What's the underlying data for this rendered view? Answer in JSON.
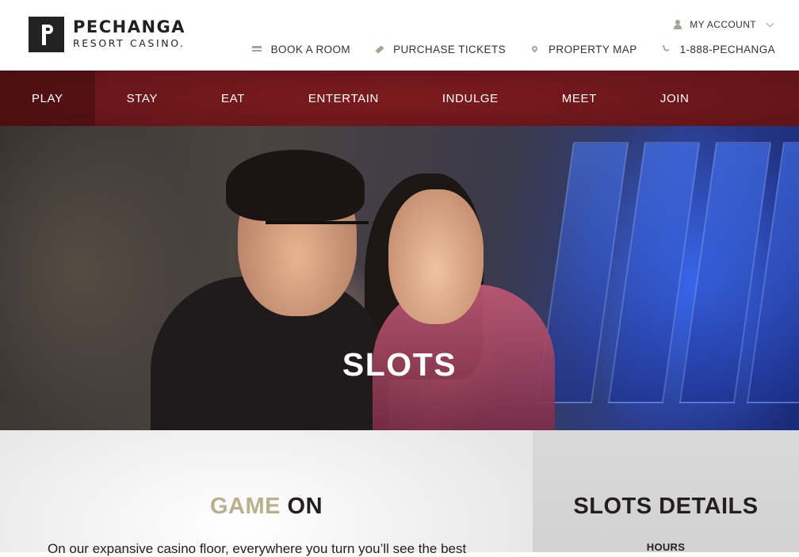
{
  "brand": {
    "name_line1": "PECHANGA",
    "name_line2": "RESORT CASINO."
  },
  "account": {
    "label": "MY ACCOUNT"
  },
  "utility_links": [
    {
      "icon": "bed-icon",
      "label": "BOOK A ROOM"
    },
    {
      "icon": "ticket-icon",
      "label": "PURCHASE TICKETS"
    },
    {
      "icon": "map-pin-icon",
      "label": "PROPERTY MAP"
    },
    {
      "icon": "phone-icon",
      "label": "1-888-PECHANGA"
    }
  ],
  "nav": [
    {
      "label": "PLAY",
      "active": true
    },
    {
      "label": "STAY"
    },
    {
      "label": "EAT"
    },
    {
      "label": "ENTERTAIN"
    },
    {
      "label": "INDULGE"
    },
    {
      "label": "MEET"
    },
    {
      "label": "JOIN"
    }
  ],
  "hero": {
    "title": "SLOTS"
  },
  "intro": {
    "title_light": "GAME",
    "title_bold": "ON",
    "body": "On our expansive casino floor, everywhere you turn you’ll see the best"
  },
  "details": {
    "title_light": "SLOTS",
    "title_bold": "DETAILS",
    "hours_label": "HOURS"
  },
  "colors": {
    "nav_bg": "#5e1317",
    "accent_gold": "#b9b08e",
    "icon_tan": "#a8a294",
    "text_dark": "#231f20"
  }
}
